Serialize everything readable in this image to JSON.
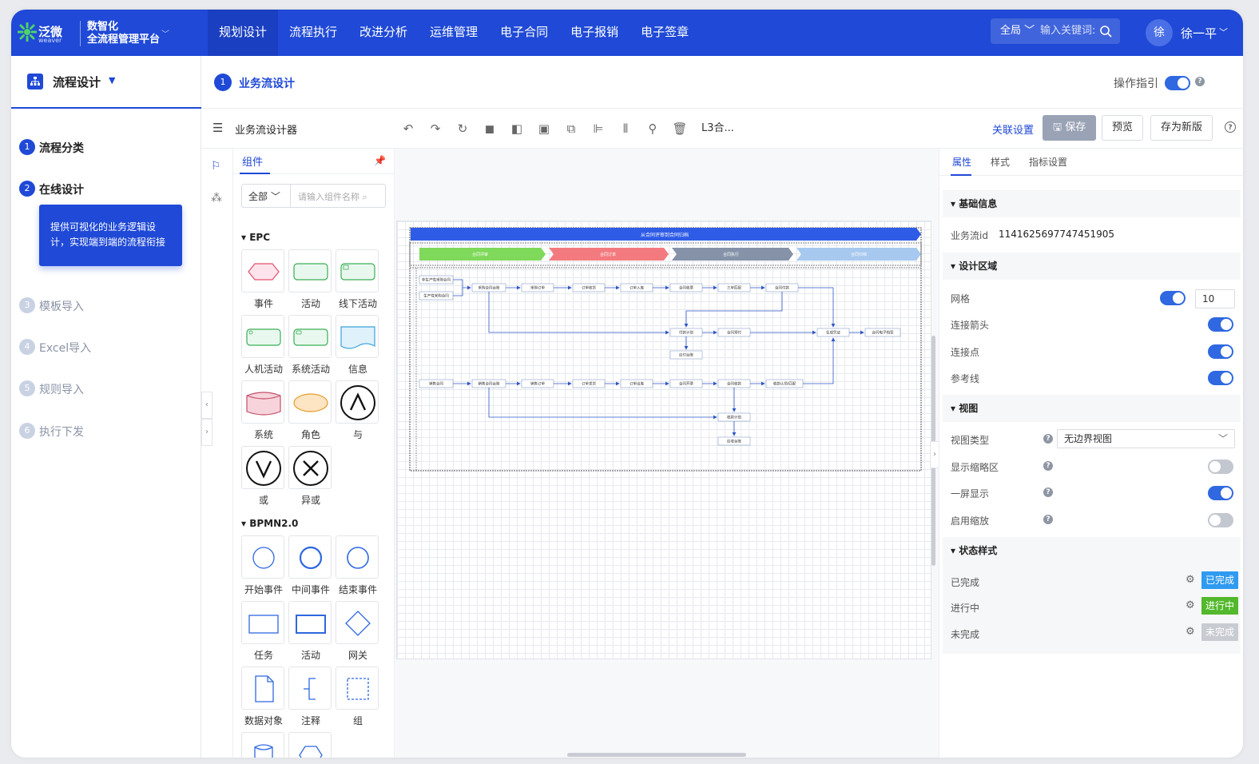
{
  "header": {
    "logo_text": "泛微",
    "logo_sub": "weaver",
    "brand_line1": "数智化",
    "brand_line2": "全流程管理平台",
    "nav": [
      "规划设计",
      "流程执行",
      "改进分析",
      "运维管理",
      "电子合同",
      "电子报销",
      "电子签章"
    ],
    "search_scope": "全局",
    "search_placeholder": "输入关键词",
    "avatar": "徐",
    "username": "徐一平"
  },
  "sidebar": {
    "title": "流程设计",
    "steps": [
      {
        "num": "1",
        "label": "流程分类"
      },
      {
        "num": "2",
        "label": "在线设计"
      },
      {
        "num": "3",
        "label": "模板导入"
      },
      {
        "num": "4",
        "label": "Excel导入"
      },
      {
        "num": "5",
        "label": "规则导入"
      },
      {
        "num": "6",
        "label": "执行下发"
      }
    ],
    "tip": "提供可视化的业务逻辑设计，实现端到端的流程衔接"
  },
  "subheader": {
    "step_num": "1",
    "title": "业务流设计",
    "guide_label": "操作指引"
  },
  "toolbar": {
    "title": "业务流设计器",
    "text_tool": "L3合...",
    "link_label": "关联设置",
    "save_label": "保存",
    "preview_label": "预览",
    "save_new_label": "存为新版"
  },
  "palette": {
    "tab": "组件",
    "filter_value": "全部",
    "filter_placeholder": "请输入组件名称",
    "sections": [
      {
        "title": "EPC",
        "items": [
          "事件",
          "活动",
          "线下活动",
          "人机活动",
          "系统活动",
          "信息",
          "系统",
          "角色",
          "与",
          "或",
          "异或"
        ]
      },
      {
        "title": "BPMN2.0",
        "items": [
          "开始事件",
          "中间事件",
          "结束事件",
          "任务",
          "活动",
          "网关",
          "数据对象",
          "注释",
          "组"
        ]
      }
    ]
  },
  "diagram": {
    "title": "从合同评审到合同归档",
    "phases": [
      "合同评审",
      "合同订单",
      "合同执行",
      "合同归档"
    ],
    "row1": [
      "采购合同台账",
      "采购订单",
      "订单收货",
      "订单入库",
      "合同收票",
      "三单匹配",
      "合同付款"
    ],
    "row1_inputs": [
      "非生产性采购合同",
      "生产性采购合同"
    ],
    "row2": [
      "付款计划",
      "合同预付",
      "生成凭证",
      "合同电子档案"
    ],
    "row2_sub": "应付台账",
    "row3": [
      "销售合同",
      "销售合同台账",
      "销售订单",
      "订单发货",
      "订单出库",
      "合同开票",
      "合同收款",
      "收款认领/匹配"
    ],
    "row4": [
      "收款计划",
      "应收台账"
    ]
  },
  "properties": {
    "tabs": [
      "属性",
      "样式",
      "指标设置"
    ],
    "basic_title": "基础信息",
    "flow_id_label": "业务流id",
    "flow_id": "1141625697747451905",
    "design_title": "设计区域",
    "grid_label": "网格",
    "grid_value": "10",
    "arrow_label": "连接箭头",
    "point_label": "连接点",
    "ref_label": "参考线",
    "view_title": "视图",
    "view_type_label": "视图类型",
    "view_type_value": "无边界视图",
    "minimap_label": "显示缩略区",
    "onescreen_label": "一屏显示",
    "zoom_label": "启用缩放",
    "state_title": "状态样式",
    "states": [
      {
        "label": "已完成",
        "badge": "已完成",
        "color": "#2f9bf0"
      },
      {
        "label": "进行中",
        "badge": "进行中",
        "color": "#52b82c"
      },
      {
        "label": "未完成",
        "badge": "未完成",
        "color": "#c8cbd1"
      }
    ]
  }
}
